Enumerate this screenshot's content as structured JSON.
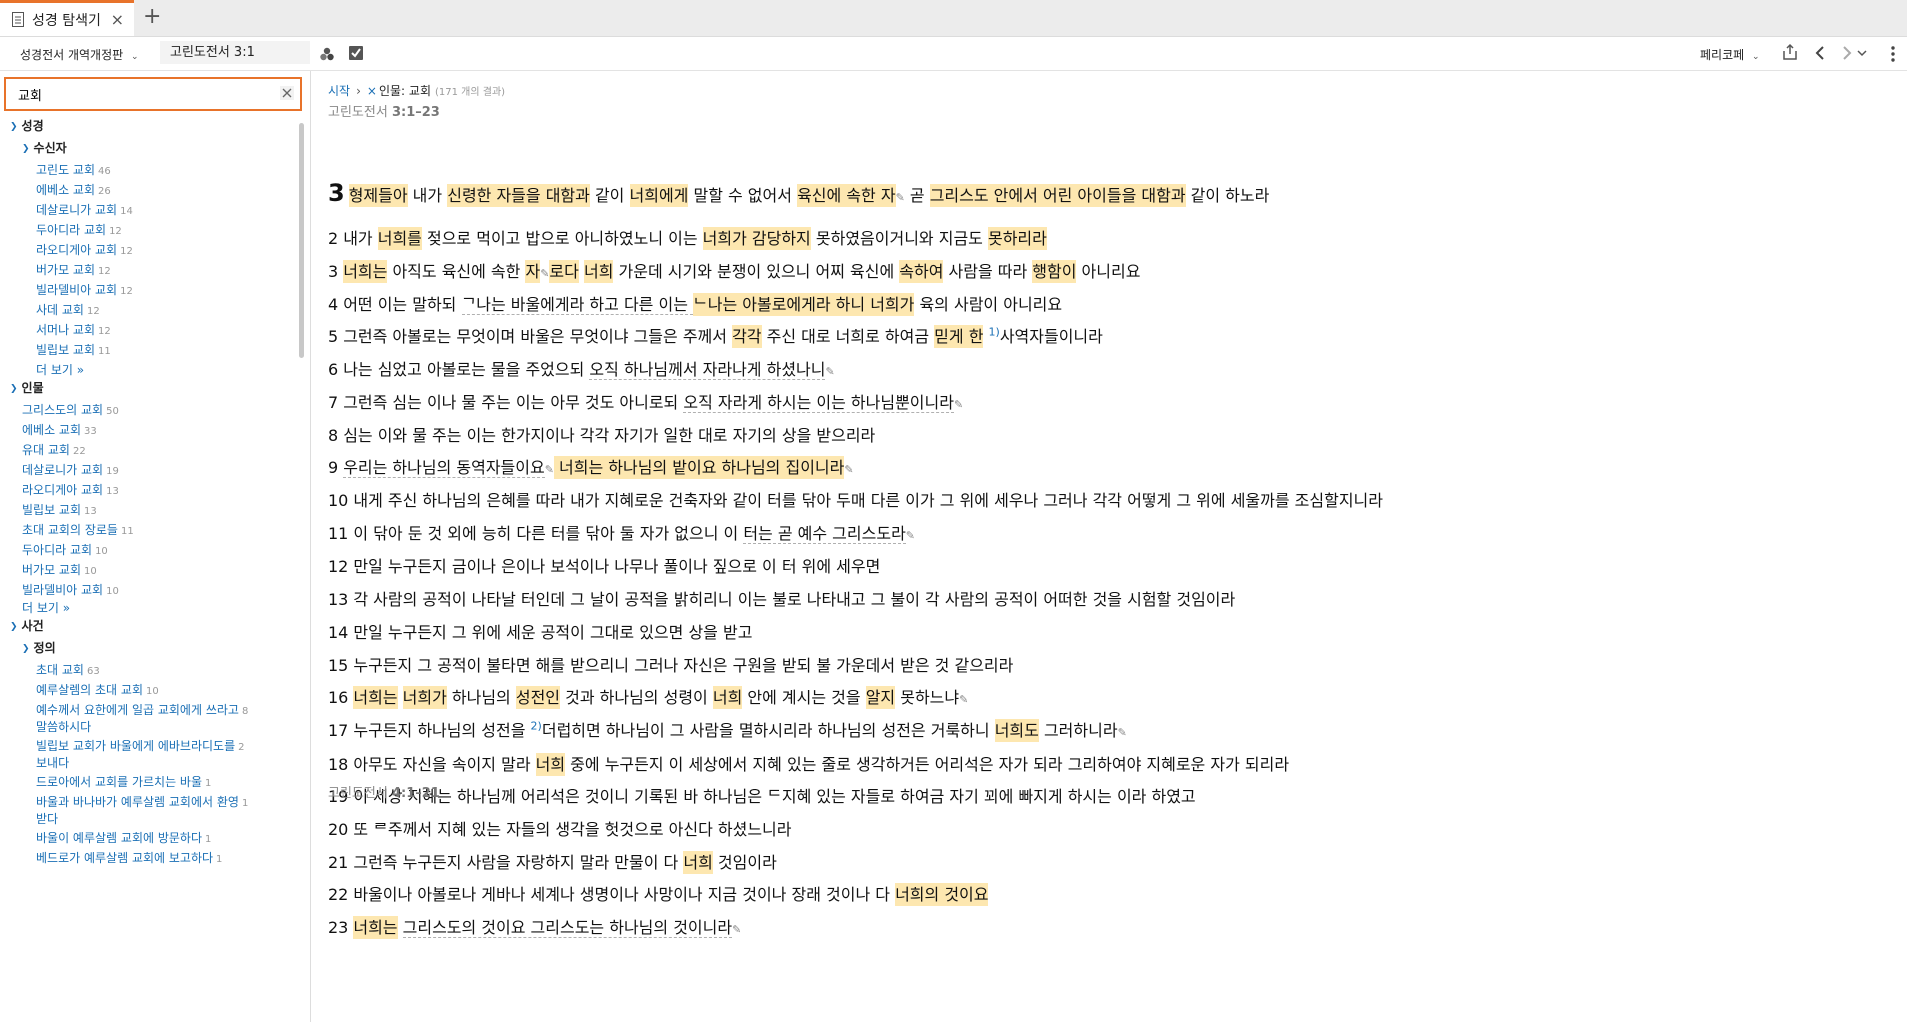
{
  "tab": {
    "title": "성경 탐색기",
    "close": "×",
    "new": "+"
  },
  "toolbar": {
    "bible_version": "성경전서 개역개정판",
    "reference": "고린도전서 3:1",
    "font": "페리코페"
  },
  "search": {
    "value": "교회"
  },
  "breadcrumb": {
    "home": "시작",
    "separator": "›",
    "remove": "×",
    "filter": "인물: 교회",
    "results": "(171 개의 결과)"
  },
  "sidebar": {
    "groups": [
      {
        "label": "성경"
      },
      {
        "label": "수신자"
      },
      {
        "label": "인물"
      },
      {
        "label": "사건"
      },
      {
        "label": "정의"
      }
    ],
    "recipients": [
      {
        "name": "고린도 교회",
        "count": "46"
      },
      {
        "name": "에베소 교회",
        "count": "26"
      },
      {
        "name": "데살로니가 교회",
        "count": "14"
      },
      {
        "name": "두아디라 교회",
        "count": "12"
      },
      {
        "name": "라오디게아 교회",
        "count": "12"
      },
      {
        "name": "버가모 교회",
        "count": "12"
      },
      {
        "name": "빌라델비아 교회",
        "count": "12"
      },
      {
        "name": "사데 교회",
        "count": "12"
      },
      {
        "name": "서머나 교회",
        "count": "12"
      },
      {
        "name": "빌립보 교회",
        "count": "11"
      }
    ],
    "people": [
      {
        "name": "그리스도의 교회",
        "count": "50"
      },
      {
        "name": "에베소 교회",
        "count": "33"
      },
      {
        "name": "유대 교회",
        "count": "22"
      },
      {
        "name": "데살로니가 교회",
        "count": "19"
      },
      {
        "name": "라오디게아 교회",
        "count": "13"
      },
      {
        "name": "빌립보 교회",
        "count": "13"
      },
      {
        "name": "초대 교회의 장로들",
        "count": "11"
      },
      {
        "name": "두아디라 교회",
        "count": "10"
      },
      {
        "name": "버가모 교회",
        "count": "10"
      },
      {
        "name": "빌라델비아 교회",
        "count": "10"
      }
    ],
    "definitions": [
      {
        "name": "초대 교회",
        "count": "63"
      },
      {
        "name": "예루살렘의 초대 교회",
        "count": "10"
      },
      {
        "name": "예수께서 요한에게 일곱 교회에게 쓰라고",
        "name2": "말씀하시다",
        "count": "8"
      },
      {
        "name": "빌립보 교회가 바울에게 에바브라디도를",
        "name2": "보내다",
        "count": "2"
      },
      {
        "name": "드로아에서 교회를 가르치는 바울",
        "count": "1"
      },
      {
        "name": "바울과 바나바가 예루살렘 교회에서 환영",
        "name2": "받다",
        "count": "1"
      },
      {
        "name": "바울이 예루살렘 교회에 방문하다",
        "count": "1"
      },
      {
        "name": "베드로가 예루살렘 교회에 보고하다",
        "count": "1"
      }
    ],
    "more": "더 보기 »"
  },
  "section_top": {
    "book": "고린도전서",
    "range": "3:1–23"
  },
  "section_bottom": {
    "book": "고린도전서",
    "range": "4:1–21"
  },
  "verses": {
    "v1": {
      "n": "3",
      "s": [
        "형제들아",
        " 내가 ",
        "신령한 자들을 대함과",
        " 같이 ",
        "너희에게",
        " 말할 수 없어서 ",
        "육신에 속한 자",
        "✎",
        " 곧 ",
        "그리스도 안에서 어린 아이들을 대함과",
        " 같이 하노라"
      ]
    },
    "v2": {
      "n": "2",
      "s": [
        "내가 ",
        "너희를",
        " 젖으로 먹이고 밥으로 아니하였노니 이는 ",
        "너희가 감당하지",
        " 못하였음이거니와 지금도 ",
        "못하리라"
      ]
    },
    "v3": {
      "n": "3",
      "s": [
        "너희는",
        " 아직도 육신에 속한 ",
        "자",
        "✎",
        "로다",
        " ",
        "너희",
        " 가운데 시기와 분쟁이 있으니 어찌 육신에 ",
        "속하여",
        " 사람을 따라 ",
        "행함이",
        " 아니리요"
      ]
    },
    "v4": {
      "n": "4",
      "s": [
        "어떤 이는 말하되 ",
        "ᄀ나는 바울에게라 하고 다른 이는 ",
        "ᄂ나는 아볼로에게라 하니 ",
        "너희가",
        " 육의 사람이 아니리요"
      ]
    },
    "v5": {
      "n": "5",
      "s": [
        "그런즉 아볼로는 무엇이며 바울은 무엇이냐 그들은 주께서 ",
        "각각",
        " 주신 대로 너희로 하여금 ",
        "믿게 한",
        " ",
        "1)",
        "사역자들이니라"
      ]
    },
    "v6": {
      "n": "6",
      "s": [
        "나는 심었고 아볼로는 물을 주었으되 ",
        "오직 하나님께서 자라나게 하셨나니",
        "✎"
      ]
    },
    "v7": {
      "n": "7",
      "s": [
        "그런즉 심는 이나 물 주는 이는 아무 것도 아니로되 ",
        "오직 자라게 하시는 이는 하나님뿐이니라",
        "✎"
      ]
    },
    "v8": {
      "n": "8",
      "s": [
        "심는 이와 물 주는 이는 한가지이나 각각 자기가 일한 대로 자기의 상을 받으리라"
      ]
    },
    "v9": {
      "n": "9",
      "s": [
        "우리는 하나님의 동역자들이요",
        "✎",
        " ",
        "너희는 하나님의 밭이요 하나님의 집이니라",
        "✎"
      ]
    },
    "v10": {
      "n": "10",
      "s": [
        "내게 주신 하나님의 은혜를 따라 내가 지혜로운 건축자와 같이 터를 닦아 두매 다른 이가 그 위에 세우나 그러나 각각 어떻게 그 위에 세울까를 조심할지니라"
      ]
    },
    "v11": {
      "n": "11",
      "s": [
        "이 닦아 둔 것 외에 능히 다른 터를 닦아 둘 자가 없으니 이 ",
        "터는 곧 예수 그리스도라",
        "✎"
      ]
    },
    "v12": {
      "n": "12",
      "s": [
        "만일 누구든지 금이나 은이나 보석이나 나무나 풀이나 짚으로 이 터 위에 세우면"
      ]
    },
    "v13": {
      "n": "13",
      "s": [
        "각 사람의 공적이 나타날 터인데 그 날이 공적을 밝히리니 이는 불로 나타내고 그 불이 각 사람의 공적이 어떠한 것을 시험할 것임이라"
      ]
    },
    "v14": {
      "n": "14",
      "s": [
        "만일 누구든지 그 위에 세운 공적이 그대로 있으면 상을 받고"
      ]
    },
    "v15": {
      "n": "15",
      "s": [
        "누구든지 그 공적이 불타면 해를 받으리니 그러나 자신은 구원을 받되 불 가운데서 받은 것 같으리라"
      ]
    },
    "v16": {
      "n": "16",
      "s": [
        "너희는",
        " ",
        "너희가",
        " 하나님의 ",
        "성전인",
        " 것과 하나님의 성령이 ",
        "너희",
        " 안에 계시는 것을 ",
        "알지",
        " 못하느냐",
        "✎"
      ]
    },
    "v17": {
      "n": "17",
      "s": [
        "누구든지 하나님의 성전을 ",
        "2)",
        "더럽히면 하나님이 그 사람을 멸하시리라 하나님의 성전은 거룩하니 ",
        "너희도",
        " 그러하니라",
        "✎"
      ]
    },
    "v18": {
      "n": "18",
      "s": [
        "아무도 자신을 속이지 말라 ",
        "너희",
        " 중에 누구든지 이 세상에서 지혜 있는 줄로 생각하거든 어리석은 자가 되라 그리하여야 지혜로운 자가 되리라"
      ]
    },
    "v19": {
      "n": "19",
      "s": [
        "이 세상 지혜는 하나님께 어리석은 것이니 기록된 바 하나님은 ",
        "ᄃ지혜 있는 자들로 하여금 자기 꾀에 빠지게 하시는 이라 하였고"
      ]
    },
    "v20": {
      "n": "20",
      "s": [
        "또 ",
        "ᄅ주께서 지혜 있는 자들의 생각을 헛것으로 아신다 하셨느니라"
      ]
    },
    "v21": {
      "n": "21",
      "s": [
        "그런즉 누구든지 사람을 자랑하지 말라 만물이 다 ",
        "너희",
        " 것임이라"
      ]
    },
    "v22": {
      "n": "22",
      "s": [
        "바울이나 아볼로나 게바나 세계나 생명이나 사망이나 지금 것이나 장래 것이나 다 ",
        "너희의 것이요"
      ]
    },
    "v23": {
      "n": "23",
      "s": [
        "너희는",
        " ",
        "그리스도의 것이요 그리스도는 하나님의 것이니라",
        "✎"
      ]
    }
  }
}
